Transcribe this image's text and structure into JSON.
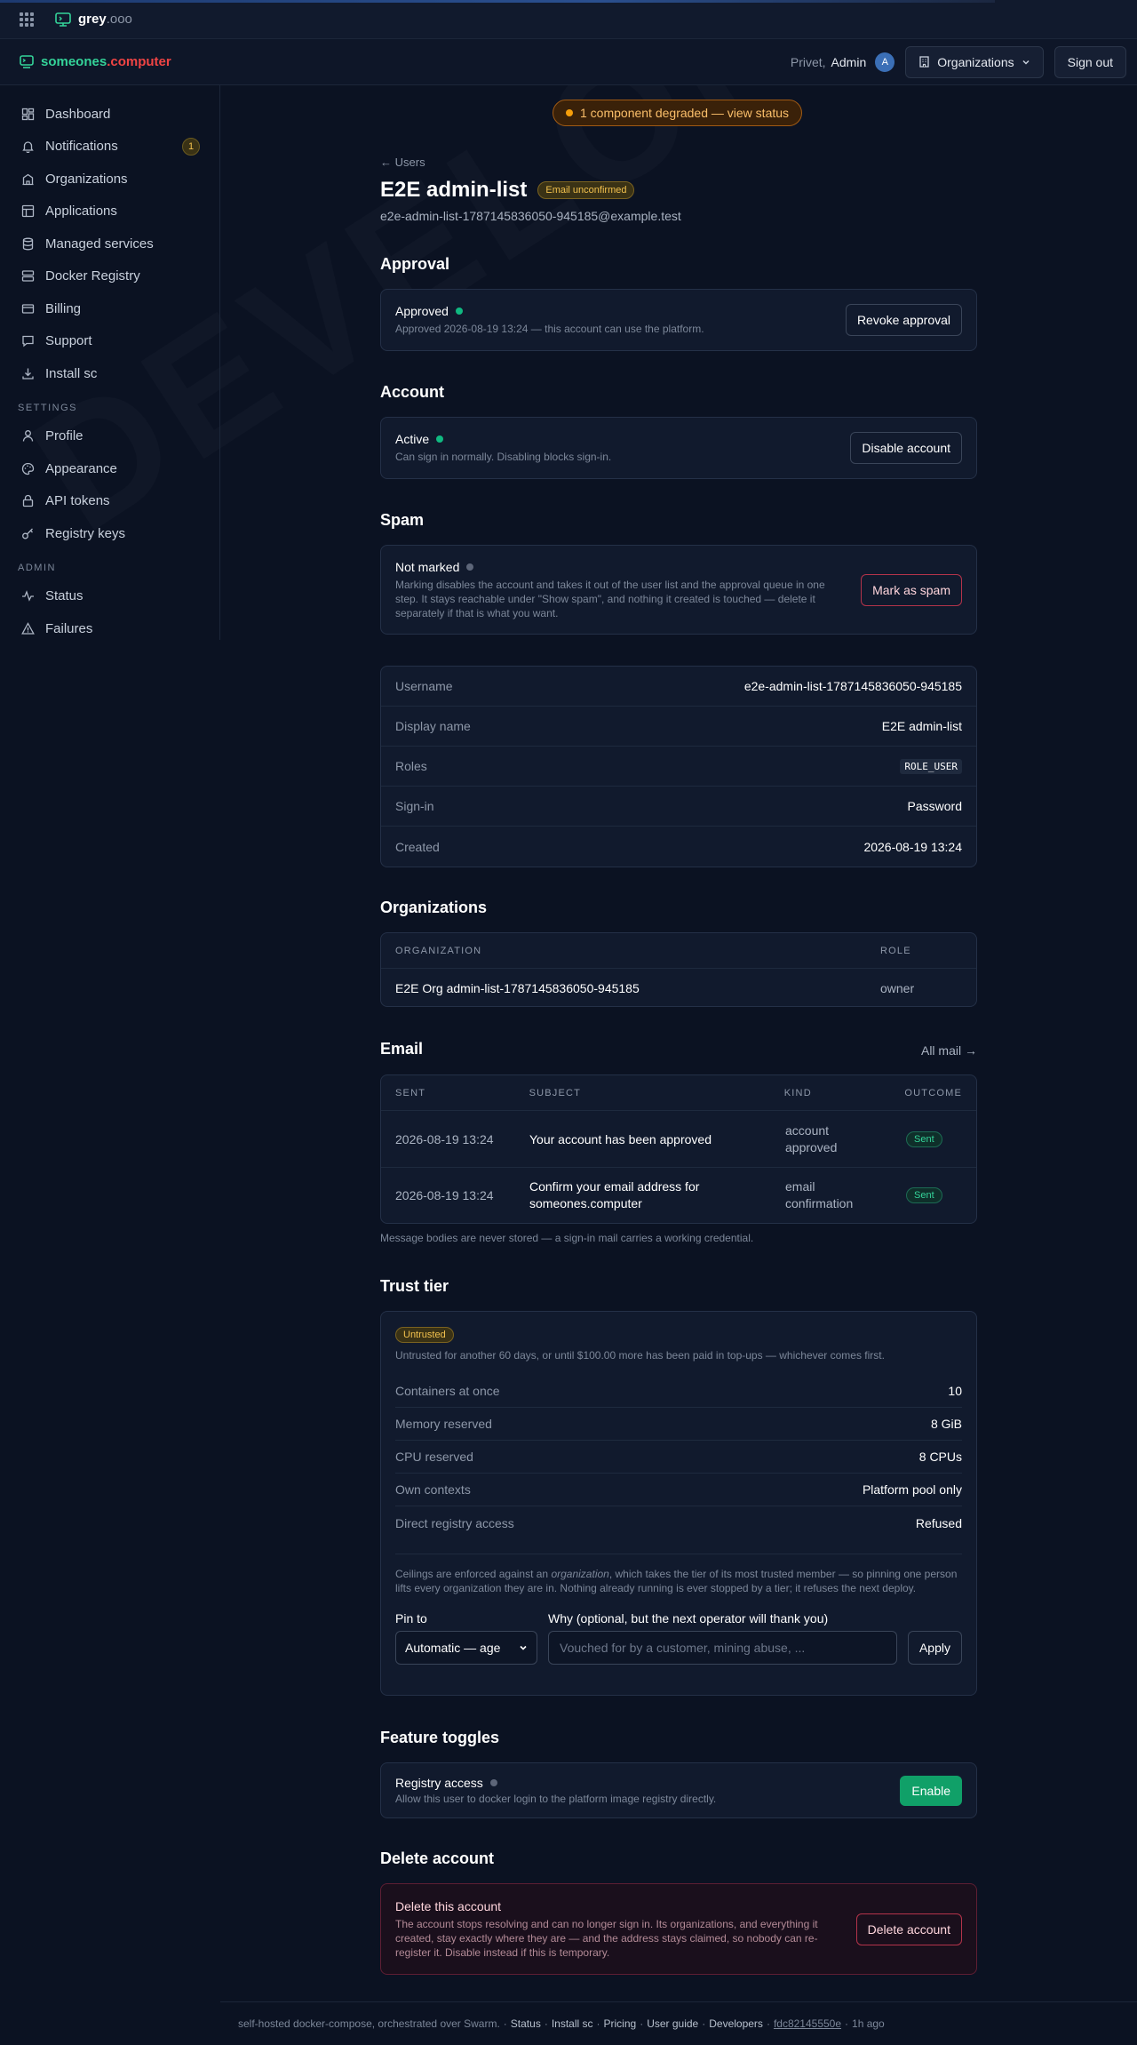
{
  "topbar": {
    "brand_a": "grey",
    "brand_b": ".ooo"
  },
  "header": {
    "logo_a": "someones",
    "logo_b": ".computer",
    "greeting": "Privet,",
    "user": "Admin",
    "avatar_initial": "A",
    "orgs_label": "Organizations",
    "signout_label": "Sign out"
  },
  "sidebar": {
    "items": [
      {
        "label": "Dashboard",
        "icon": "dashboard-icon"
      },
      {
        "label": "Notifications",
        "icon": "bell-icon",
        "badge": "1"
      },
      {
        "label": "Organizations",
        "icon": "building-icon"
      },
      {
        "label": "Applications",
        "icon": "layout-icon"
      },
      {
        "label": "Managed services",
        "icon": "database-icon"
      },
      {
        "label": "Docker Registry",
        "icon": "server-icon"
      },
      {
        "label": "Billing",
        "icon": "credit-card-icon"
      },
      {
        "label": "Support",
        "icon": "chat-icon"
      },
      {
        "label": "Install sc",
        "icon": "download-icon"
      }
    ],
    "settings_heading": "SETTINGS",
    "settings_items": [
      {
        "label": "Profile",
        "icon": "user-icon"
      },
      {
        "label": "Appearance",
        "icon": "palette-icon"
      },
      {
        "label": "API tokens",
        "icon": "lock-icon"
      },
      {
        "label": "Registry keys",
        "icon": "key-icon"
      }
    ],
    "admin_heading": "ADMIN",
    "admin_items": [
      {
        "label": "Status",
        "icon": "activity-icon"
      },
      {
        "label": "Failures",
        "icon": "warning-icon"
      }
    ]
  },
  "banner": {
    "text": "1 component degraded — view status"
  },
  "watermark": "DEVELOPMENT",
  "user": {
    "back_label": "Users",
    "title": "E2E admin-list",
    "email_badge": "Email unconfirmed",
    "email": "e2e-admin-list-1787145836050-945185@example.test"
  },
  "approval": {
    "heading": "Approval",
    "status": "Approved",
    "detail": "Approved 2026-08-19 13:24 — this account can use the platform.",
    "button": "Revoke approval"
  },
  "account": {
    "heading": "Account",
    "status": "Active",
    "detail": "Can sign in normally. Disabling blocks sign-in.",
    "button": "Disable account"
  },
  "spam": {
    "heading": "Spam",
    "status": "Not marked",
    "detail": "Marking disables the account and takes it out of the user list and the approval queue in one step. It stays reachable under \"Show spam\", and nothing it created is touched — delete it separately if that is what you want.",
    "button": "Mark as spam"
  },
  "details": [
    {
      "k": "Username",
      "v": "e2e-admin-list-1787145836050-945185"
    },
    {
      "k": "Display name",
      "v": "E2E admin-list"
    },
    {
      "k": "Roles",
      "v": "ROLE_USER"
    },
    {
      "k": "Sign-in",
      "v": "Password"
    },
    {
      "k": "Created",
      "v": "2026-08-19 13:24"
    }
  ],
  "organizations": {
    "heading": "Organizations",
    "col_org": "ORGANIZATION",
    "col_role": "ROLE",
    "rows": [
      {
        "org": "E2E Org admin-list-1787145836050-945185",
        "role": "owner"
      }
    ]
  },
  "email": {
    "heading": "Email",
    "all_mail": "All mail →",
    "cols": [
      "SENT",
      "SUBJECT",
      "KIND",
      "OUTCOME"
    ],
    "rows": [
      {
        "sent": "2026-08-19 13:24",
        "subject": "Your account has been approved",
        "kind": "account approved",
        "outcome": "Sent"
      },
      {
        "sent": "2026-08-19 13:24",
        "subject": "Confirm your email address for someones.computer",
        "kind": "email confirmation",
        "outcome": "Sent"
      }
    ],
    "note": "Message bodies are never stored — a sign-in mail carries a working credential."
  },
  "trust": {
    "heading": "Trust tier",
    "badge": "Untrusted",
    "detail": "Untrusted for another 60 days, or until $100.00 more has been paid in top-ups — whichever comes first.",
    "limits": [
      {
        "k": "Containers at once",
        "v": "10"
      },
      {
        "k": "Memory reserved",
        "v": "8 GiB"
      },
      {
        "k": "CPU reserved",
        "v": "8 CPUs"
      },
      {
        "k": "Own contexts",
        "v": "Platform pool only"
      },
      {
        "k": "Direct registry access",
        "v": "Refused"
      }
    ],
    "note_a": "Ceilings are enforced against an ",
    "note_em": "organization",
    "note_b": ", which takes the tier of its most trusted member — so pinning one person lifts every organization they are in. Nothing already running is ever stopped by a tier; it refuses the next deploy.",
    "pin_label": "Pin to",
    "pin_value": "Automatic — age",
    "why_label": "Why (optional, but the next operator will thank you)",
    "why_placeholder": "Vouched for by a customer, mining abuse, ...",
    "apply": "Apply"
  },
  "toggles": {
    "heading": "Feature toggles",
    "name": "Registry access",
    "detail": "Allow this user to docker login to the platform image registry directly.",
    "button": "Enable"
  },
  "delete": {
    "heading": "Delete account",
    "title": "Delete this account",
    "detail": "The account stops resolving and can no longer sign in. Its organizations, and everything it created, stay exactly where they are — and the address stays claimed, so nobody can re-register it. Disable instead if this is temporary.",
    "button": "Delete account"
  },
  "footer": {
    "text": "self-hosted docker-compose, orchestrated over Swarm.",
    "links": [
      "Status",
      "Install sc",
      "Pricing",
      "User guide",
      "Developers"
    ],
    "hash": "fdc82145550e",
    "ago": "1h ago"
  }
}
